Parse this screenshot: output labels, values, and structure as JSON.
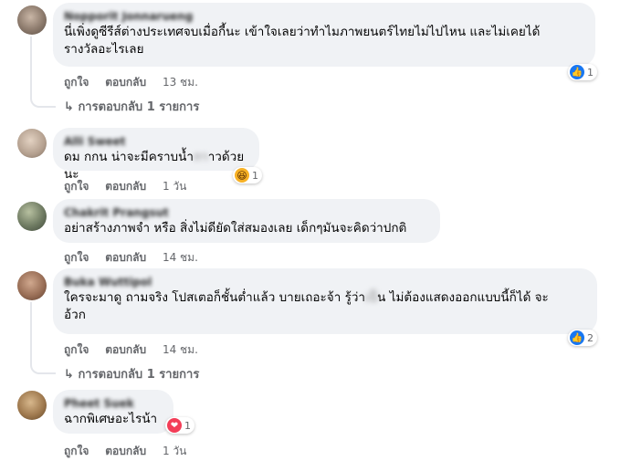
{
  "comments": [
    {
      "author": "Nopporit Jonnarueng",
      "text_line1": "นี่เพิ่งดูซีรีส์ต่างประเทศจบเมื่อกี้นะ เข้าใจเลยว่าทำไมภาพยนตร์ไทยไม่ไปไหน และไม่เคยได้",
      "text_line2": "รางวัลอะไรเลย",
      "like": "ถูกใจ",
      "reply": "ตอบกลับ",
      "time": "13 ชม.",
      "reaction_icon": "like-icon",
      "reaction_count": "1",
      "replies_label": "การตอบกลับ 1 รายการ"
    },
    {
      "author": "Alli Sweet",
      "text_a": "ดม กกน น่าจะมีคราบน้ำ",
      "text_hidden": "กา",
      "text_b": "าวด้วยนะ",
      "like": "ถูกใจ",
      "reply": "ตอบกลับ",
      "time": "1 วัน",
      "reaction_icon": "haha-icon",
      "reaction_count": "1"
    },
    {
      "author": "Chakrit Prangsut",
      "text_line1": "อย่าสร้างภาพจำ หรือ สิ่งไม่ดียัดใส่สมองเลย เด็กๆมันจะคิดว่าปกติ",
      "like": "ถูกใจ",
      "reply": "ตอบกลับ",
      "time": "14 ชม."
    },
    {
      "author": "Buka Wuttipol",
      "text_a": "ใครจะมาดู ถามจริง โปสเตอก็ชั้นต่ำแล้ว บายเถอะจ้า รู้ว่า",
      "text_hidden": "เป็",
      "text_b": "น ไม่ต้องแสดงออกแบบนี้ก็ได้ จะ",
      "text_line2": "อ้วก",
      "like": "ถูกใจ",
      "reply": "ตอบกลับ",
      "time": "14 ชม.",
      "reaction_icon": "like-icon",
      "reaction_count": "2",
      "replies_label": "การตอบกลับ 1 รายการ"
    },
    {
      "author": "Pheet Suek",
      "text_line1": "ฉากพิเศษอะไรน้า",
      "like": "ถูกใจ",
      "reply": "ตอบกลับ",
      "time": "1 วัน",
      "reaction_icon": "love-icon",
      "reaction_count": "1"
    }
  ],
  "icons": {
    "reply_arrow": "↳"
  },
  "colors": {
    "bubble": "#f0f2f5",
    "meta": "#65676b",
    "like": "#1877f2"
  }
}
